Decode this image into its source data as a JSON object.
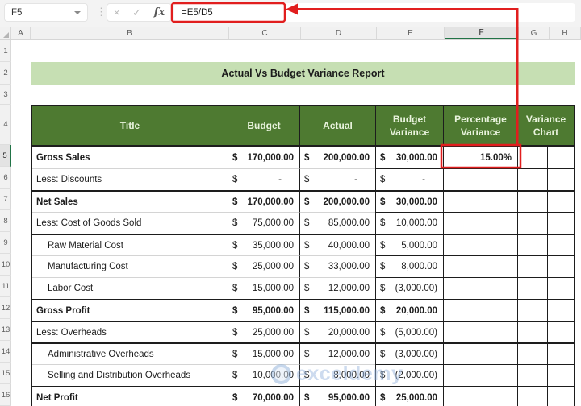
{
  "formula_bar": {
    "cell_reference": "F5",
    "separator_dots": "⋮",
    "cancel_label": "×",
    "enter_label": "✓",
    "fx_label": "fx",
    "formula": "=E5/D5"
  },
  "sheet": {
    "column_letters": [
      "A",
      "B",
      "C",
      "D",
      "E",
      "F",
      "G",
      "H"
    ],
    "selected_column": "F",
    "row_numbers": [
      "1",
      "2",
      "3",
      "4",
      "5",
      "6",
      "7",
      "8",
      "9",
      "10",
      "11",
      "12",
      "13",
      "14",
      "15",
      "16"
    ],
    "selected_row": "5"
  },
  "report": {
    "title": "Actual Vs Budget Variance Report",
    "currency_symbol": "$",
    "columns": [
      "Title",
      "Budget",
      "Actual",
      "Budget Variance",
      "Percentage Variance",
      "Variance Chart"
    ],
    "rows": [
      {
        "title": "Gross Sales",
        "bold": true,
        "indent": false,
        "rule": false,
        "budget": "170,000.00",
        "actual": "200,000.00",
        "variance": "30,000.00",
        "pct": "15.00%"
      },
      {
        "title": "Less: Discounts",
        "bold": false,
        "indent": false,
        "rule": false,
        "budget": "-",
        "actual": "-",
        "variance": "-",
        "pct": ""
      },
      {
        "title": "Net Sales",
        "bold": true,
        "indent": false,
        "rule": true,
        "budget": "170,000.00",
        "actual": "200,000.00",
        "variance": "30,000.00",
        "pct": ""
      },
      {
        "title": "Less: Cost of Goods Sold",
        "bold": false,
        "indent": false,
        "rule": false,
        "budget": "75,000.00",
        "actual": "85,000.00",
        "variance": "10,000.00",
        "pct": ""
      },
      {
        "title": "Raw Material Cost",
        "bold": false,
        "indent": true,
        "rule": true,
        "budget": "35,000.00",
        "actual": "40,000.00",
        "variance": "5,000.00",
        "pct": ""
      },
      {
        "title": "Manufacturing Cost",
        "bold": false,
        "indent": true,
        "rule": false,
        "budget": "25,000.00",
        "actual": "33,000.00",
        "variance": "8,000.00",
        "pct": ""
      },
      {
        "title": "Labor Cost",
        "bold": false,
        "indent": true,
        "rule": false,
        "budget": "15,000.00",
        "actual": "12,000.00",
        "variance": "(3,000.00)",
        "pct": ""
      },
      {
        "title": "Gross Profit",
        "bold": true,
        "indent": false,
        "rule": true,
        "budget": "95,000.00",
        "actual": "115,000.00",
        "variance": "20,000.00",
        "pct": ""
      },
      {
        "title": "Less: Overheads",
        "bold": false,
        "indent": false,
        "rule": true,
        "budget": "25,000.00",
        "actual": "20,000.00",
        "variance": "(5,000.00)",
        "pct": ""
      },
      {
        "title": "Administrative Overheads",
        "bold": false,
        "indent": true,
        "rule": true,
        "budget": "15,000.00",
        "actual": "12,000.00",
        "variance": "(3,000.00)",
        "pct": ""
      },
      {
        "title": "Selling and Distribution Overheads",
        "bold": false,
        "indent": true,
        "rule": false,
        "budget": "10,000.00",
        "actual": "8,000.00",
        "variance": "(2,000.00)",
        "pct": ""
      },
      {
        "title": "Net Profit",
        "bold": true,
        "indent": false,
        "rule": true,
        "budget": "70,000.00",
        "actual": "95,000.00",
        "variance": "25,000.00",
        "pct": ""
      }
    ]
  },
  "watermark": {
    "text": "exceldemy"
  },
  "colors": {
    "table_header_green": "#4e7a31",
    "title_banner_green": "#c6dfb3",
    "selection_green": "#217346",
    "annotation_red": "#e11e1e",
    "watermark_blue": "#9cb9e0"
  }
}
